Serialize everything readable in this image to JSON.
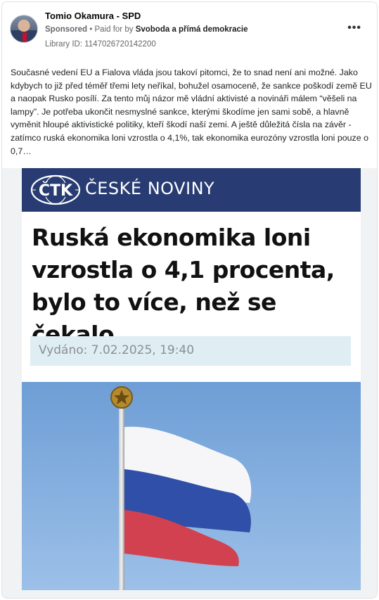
{
  "post": {
    "page_name": "Tomio Okamura - SPD",
    "sponsored": "Sponsored",
    "separator": "•",
    "paid_for_prefix": "Paid for by",
    "payer": "Svoboda a přímá demokracie",
    "library_id": "Library ID: 1147026720142200",
    "more_icon": "more-options-icon",
    "body_text": "Současné vedení EU a Fialova vláda jsou takoví pitomci, že to snad není ani možné. Jako kdybych to již před téměř třemi lety neříkal, bohužel osamoceně, že sankce poškodí země EU a naopak Rusko posílí. Za tento můj názor mě vládní aktivisté a novináři málem “věšeli na lampy”. Je potřeba ukončit nesmyslné sankce, kterými škodíme jen sami sobě, a hlavně vyměnit hloupé aktivistické politiky, kteří škodí naší zemi. A ještě důležitá čísla na závěr - zatímco ruská ekonomika loni vzrostla o 4,1%, tak ekonomika eurozóny vzrostla loni pouze o 0,7…"
  },
  "creative": {
    "logo_text": "ČTK",
    "brand_name": "ČESKÉ NOVINY",
    "headline_lines": [
      "Ruská ekonomika loni",
      "vzrostla o 4,1 procenta,",
      "bylo to více, než se čekalo"
    ],
    "published": "Vydáno: 7.02.2025, 19:40",
    "colors": {
      "banner": "#283c73",
      "date_box": "#dfeef2",
      "sky": "#7fa9dc"
    }
  }
}
